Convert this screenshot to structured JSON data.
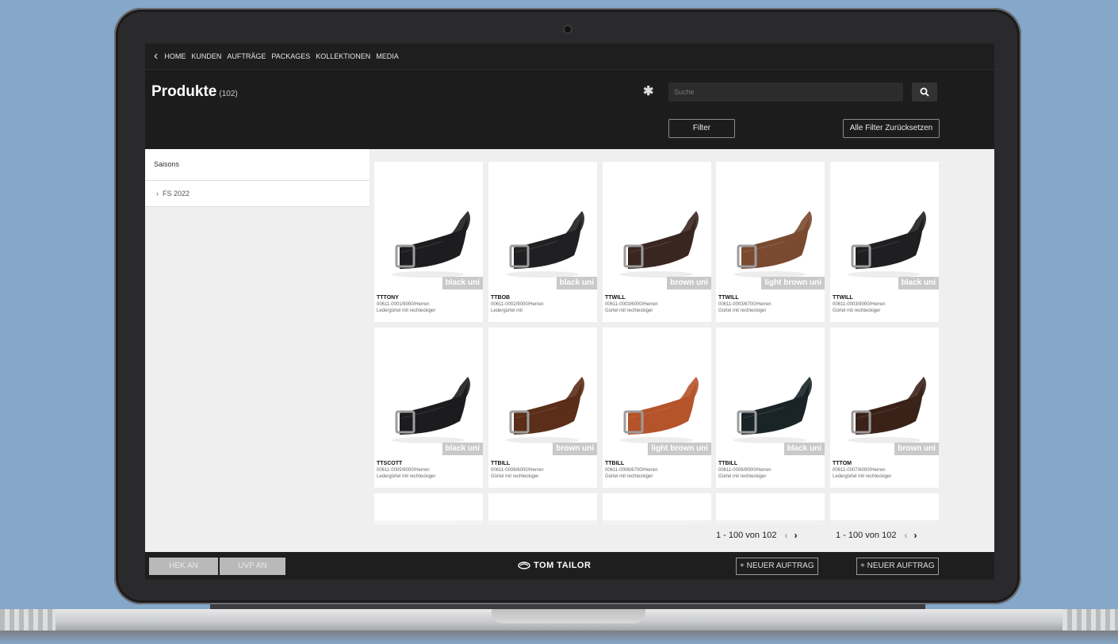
{
  "nav": {
    "back_icon": "chevron-left-icon",
    "items": [
      "HOME",
      "KUNDEN",
      "AUFTRÄGE",
      "PACKAGES",
      "KOLLEKTIONEN",
      "MEDIA"
    ]
  },
  "header": {
    "title": "Produkte",
    "count": "(102)",
    "search_placeholder": "Suche",
    "filter_label": "Filter",
    "reset_label": "Alle Filter Zurücksetzen"
  },
  "sidebar": {
    "heading": "Saisons",
    "items": [
      {
        "label": "FS 2022"
      }
    ]
  },
  "products": [
    {
      "name": "TTTONY",
      "code": "00611-0001/9000/Herren",
      "desc": "Ledergürtel mit rechteckiger",
      "color": "black uni",
      "belt": "#1d1d1f"
    },
    {
      "name": "TTBOB",
      "code": "00611-0002/9000/Herren",
      "desc": "Ledergürtel mit",
      "color": "black uni",
      "belt": "#202022"
    },
    {
      "name": "TTWILL",
      "code": "00611-0003/6000/Herren",
      "desc": "Gürtel mit rechteckiger",
      "color": "brown uni",
      "belt": "#3a2620"
    },
    {
      "name": "TTWILL",
      "code": "00611-0003/6700/Herren",
      "desc": "Gürtel mit rechteckiger",
      "color": "light brown uni",
      "belt": "#7a4a30"
    },
    {
      "name": "TTWILL",
      "code": "00611-0003/9000/Herren",
      "desc": "Gürtel mit rechteckiger",
      "color": "black uni",
      "belt": "#1f1f21"
    },
    {
      "name": "TTSCOTT",
      "code": "00611-0005/9000/Herren",
      "desc": "Ledergürtel mit rechteckiger",
      "color": "black uni",
      "belt": "#1c1c1e"
    },
    {
      "name": "TTBILL",
      "code": "00611-0006/6000/Herren",
      "desc": "Gürtel mit rechteckiger",
      "color": "brown uni",
      "belt": "#5a2e18"
    },
    {
      "name": "TTBILL",
      "code": "00611-0006/6700/Herren",
      "desc": "Gürtel mit rechteckiger",
      "color": "light brown uni",
      "belt": "#b5532a"
    },
    {
      "name": "TTBILL",
      "code": "00611-0006/9000/Herren",
      "desc": "Gürtel mit rechteckiger",
      "color": "black uni",
      "belt": "#1a2426"
    },
    {
      "name": "TTTOM",
      "code": "00611-0007/6000/Herren",
      "desc": "Ledergürtel mit rechteckiger",
      "color": "brown uni",
      "belt": "#3a2218"
    }
  ],
  "pagination": {
    "label_1": "1 - 100 von 102",
    "label_2": "1 - 100 von 102"
  },
  "footer": {
    "hekan_label": "HEK AN",
    "uvpan_label": "UVP AN",
    "brand": "TOM TAILOR",
    "order_label_1": "+ NEUER AUFTRAG",
    "order_label_2": "+ NEUER AUFTRAG"
  }
}
